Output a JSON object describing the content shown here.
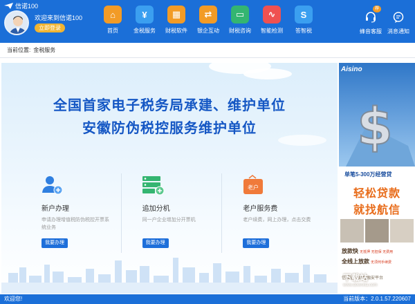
{
  "window": {
    "title": "信诺100"
  },
  "user": {
    "welcome": "欢迎来到信诺100",
    "login_label": "立即登录"
  },
  "nav": [
    {
      "label": "首页",
      "icon": "home-icon",
      "color": "#f29b26",
      "glyph": "⌂"
    },
    {
      "label": "金税服务",
      "icon": "tax-service-icon",
      "color": "#3b9ff0",
      "glyph": "¥"
    },
    {
      "label": "财税软件",
      "icon": "software-icon",
      "color": "#f29b26",
      "glyph": "▦"
    },
    {
      "label": "银企互动",
      "icon": "bank-icon",
      "color": "#f29b26",
      "glyph": "⇄"
    },
    {
      "label": "财税咨询",
      "icon": "consult-icon",
      "color": "#34b571",
      "glyph": "▭"
    },
    {
      "label": "智能检测",
      "icon": "monitor-icon",
      "color": "#ef5151",
      "glyph": "∿"
    },
    {
      "label": "答智税",
      "icon": "answer-icon",
      "color": "#3b9ff0",
      "glyph": "S"
    }
  ],
  "tools": {
    "service": {
      "label": "蜂音客服",
      "badge": "荐"
    },
    "notice": {
      "label": "消息通知"
    }
  },
  "breadcrumb": {
    "prefix": "当前位置:",
    "current": "金税服务"
  },
  "banner": {
    "line1": "全国首家电子税务局承建、维护单位",
    "line2": "安徽防伪税控服务维护单位"
  },
  "cards": [
    {
      "title": "新户办理",
      "desc": "申请办理增值税防伪税控开票系统业务",
      "button": "我要办理",
      "icon": "new-user-icon",
      "color": "#2f7fe0"
    },
    {
      "title": "追加分机",
      "desc": "同一户企业增加分开票机",
      "button": "我要办理",
      "icon": "add-machine-icon",
      "color": "#34b571"
    },
    {
      "title": "老户服务费",
      "desc": "老户续费，网上办理，点击交费",
      "button": "我要办理",
      "icon": "service-fee-icon",
      "color": "#f07a3a",
      "tag": "老户"
    }
  ],
  "ad": {
    "brand": "Aisino",
    "line1": "单笔5-300万经营贷",
    "big1": "轻松贷款",
    "big2": "就找航信",
    "row1_main": "放款快",
    "row1_note": "无抵押 无担保 无费用",
    "row2_main": "全线上放款",
    "row2_note": "无须何手续费",
    "footer": "信福征晓财智融安平台",
    "watermark": "下载站",
    "watermark_sub": "www.downxia.com"
  },
  "status": {
    "greeting": "欢迎您!",
    "version_label": "当前版本：",
    "version": "2.0.1.57.220607"
  }
}
